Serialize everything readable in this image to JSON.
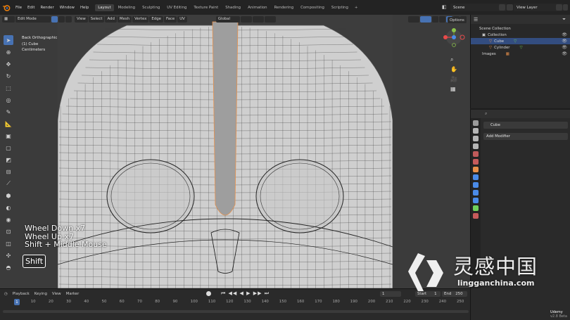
{
  "topbar": {
    "menus": [
      "File",
      "Edit",
      "Render",
      "Window",
      "Help"
    ],
    "workspaces": [
      "Layout",
      "Modeling",
      "Sculpting",
      "UV Editing",
      "Texture Paint",
      "Shading",
      "Animation",
      "Rendering",
      "Compositing",
      "Scripting"
    ],
    "active_workspace": "Layout",
    "scene": "Scene",
    "view_layer": "View Layer"
  },
  "viewport_header": {
    "mode": "Edit Mode",
    "menus": [
      "View",
      "Select",
      "Add",
      "Mesh",
      "Vertex",
      "Edge",
      "Face",
      "UV"
    ],
    "orientation": "Global",
    "options": "Options"
  },
  "viewport_info": {
    "view": "Back Orthographic",
    "object": "(1) Cube",
    "units": "Centimeters"
  },
  "key_overlay": {
    "lines": [
      "Wheel Down x7",
      "Wheel Up x7",
      "Shift + Middle Mouse"
    ],
    "key": "Shift"
  },
  "outliner": {
    "rows": [
      {
        "label": "Scene Collection",
        "icon": "collection-icon"
      },
      {
        "label": "Collection",
        "icon": "collection-icon"
      },
      {
        "label": "Cube",
        "icon": "mesh-icon",
        "selected": true
      },
      {
        "label": "Cylinder",
        "icon": "mesh-icon"
      },
      {
        "label": "Images",
        "icon": "image-icon"
      }
    ]
  },
  "properties": {
    "object_name": "Cube",
    "add_modifier": "Add Modifier"
  },
  "timeline": {
    "menus": [
      "Playback",
      "Keying",
      "View",
      "Marker"
    ],
    "current_frame": "1",
    "start_label": "Start",
    "start": "1",
    "end_label": "End",
    "end": "250",
    "ticks": [
      "1",
      "10",
      "20",
      "30",
      "40",
      "50",
      "60",
      "70",
      "80",
      "90",
      "100",
      "110",
      "120",
      "130",
      "140",
      "150",
      "160",
      "170",
      "180",
      "190",
      "200",
      "210",
      "220",
      "230",
      "240",
      "250"
    ]
  },
  "status": {
    "brand": "Udemy",
    "version": "v2.8 Beta"
  },
  "watermark": {
    "chinese": "灵感中国",
    "url": "lingganchina.com"
  },
  "colors": {
    "accent": "#4772b3",
    "selection": "#334d80",
    "mesh_orange": "#e8904a"
  }
}
